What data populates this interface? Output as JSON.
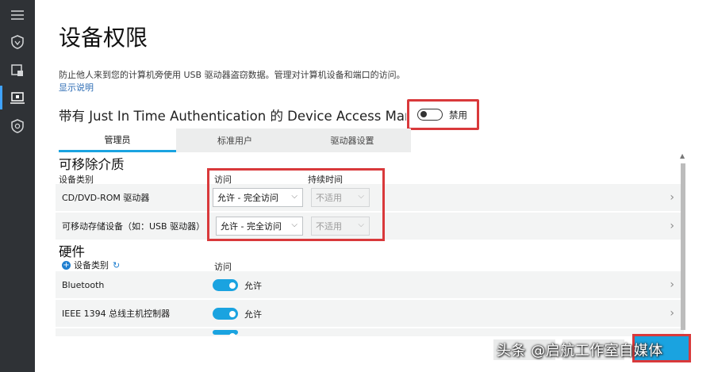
{
  "nav": {
    "items": [
      {
        "icon": "menu-icon",
        "active": false
      },
      {
        "icon": "shield-heart-icon",
        "active": false
      },
      {
        "icon": "app-browser-lock-icon",
        "active": false
      },
      {
        "icon": "device-security-icon",
        "active": true
      },
      {
        "icon": "settings-shield-icon",
        "active": false
      }
    ]
  },
  "page": {
    "title": "设备权限",
    "description": "防止他人来到您的计算机旁使用 USB 驱动器盗窃数据。管理对计算机设备和端口的访问。",
    "show_info_link": "显示说明",
    "jit_label": "带有 Just In Time Authentication 的 Device Access Manage",
    "jit_toggle_label": "禁用"
  },
  "tabs": [
    "管理员",
    "标准用户",
    "驱动器设置"
  ],
  "removable": {
    "section_title": "可移除介质",
    "col_category": "设备类别",
    "col_access": "访问",
    "col_duration": "持续时间",
    "rows": [
      {
        "label": "CD/DVD-ROM 驱动器",
        "access": "允许 - 完全访问",
        "duration": "不适用"
      },
      {
        "label": "可移动存储设备（如：USB 驱动器）",
        "access": "允许 - 完全访问",
        "duration": "不适用"
      }
    ]
  },
  "hardware": {
    "section_title": "硬件",
    "add_category": "设备类别",
    "col_access": "访问",
    "rows": [
      {
        "label": "Bluetooth",
        "toggle": "允许"
      },
      {
        "label": "IEEE 1394 总线主机控制器",
        "toggle": "允许"
      }
    ]
  },
  "watermark": "头条 @启航工作室自媒体",
  "colors": {
    "accent": "#1aa3e0",
    "highlight": "#d9393b",
    "rail": "#2f3236"
  }
}
